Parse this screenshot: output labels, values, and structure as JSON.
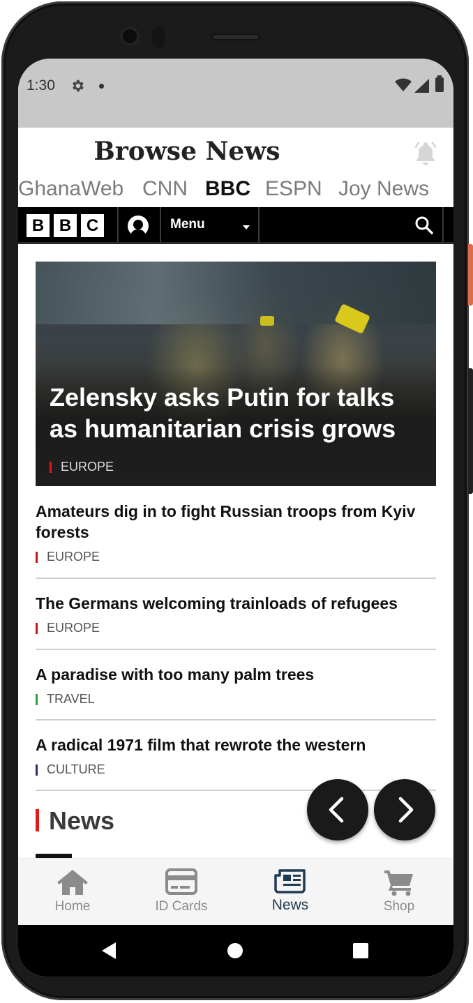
{
  "status_bar": {
    "time": "1:30"
  },
  "app": {
    "title": "Browse News",
    "tabs": [
      "GhanaWeb",
      "CNN",
      "BBC",
      "ESPN",
      "Joy News"
    ],
    "active_tab": "BBC"
  },
  "bbc": {
    "logo_letters": [
      "B",
      "B",
      "C"
    ],
    "menu_label": "Menu"
  },
  "hero": {
    "title": "Zelensky asks Putin for talks as humanitarian crisis grows",
    "tag": "EUROPE"
  },
  "articles": [
    {
      "title": "Amateurs dig in to fight Russian troops from Kyiv forests",
      "tag": "EUROPE",
      "tag_color": "#d01212"
    },
    {
      "title": "The Germans welcoming trainloads of refugees",
      "tag": "EUROPE",
      "tag_color": "#d01212"
    },
    {
      "title": "A paradise with too many palm trees",
      "tag": "TRAVEL",
      "tag_color": "#2e9e3c"
    },
    {
      "title": "A radical 1971 film that rewrote the western",
      "tag": "CULTURE",
      "tag_color": "#2c2c6a"
    }
  ],
  "section": {
    "heading": "News"
  },
  "bottom_nav": [
    {
      "label": "Home",
      "icon": "home-icon"
    },
    {
      "label": "ID Cards",
      "icon": "id-card-icon"
    },
    {
      "label": "News",
      "icon": "newspaper-icon",
      "active": true
    },
    {
      "label": "Shop",
      "icon": "cart-icon"
    }
  ]
}
